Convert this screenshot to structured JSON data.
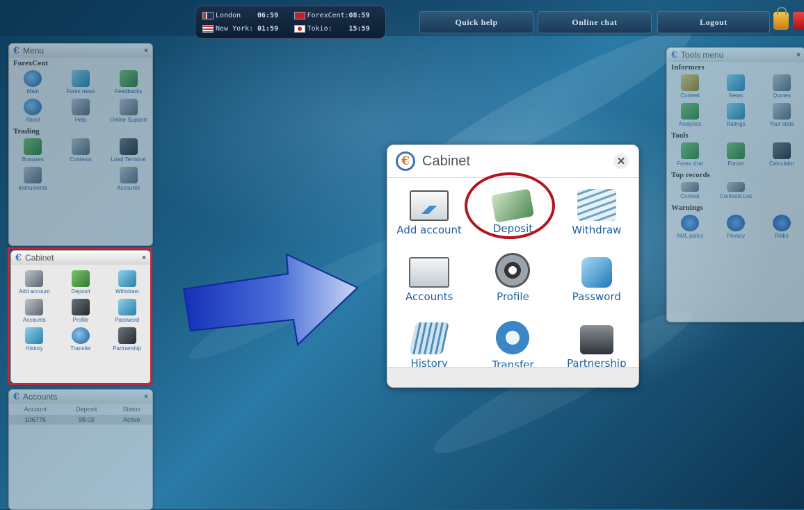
{
  "clocks": [
    {
      "city": "London",
      "time": "06:59",
      "flag": "uk"
    },
    {
      "city": "ForexCent:",
      "time": "08:59",
      "flag": "fc"
    },
    {
      "city": "New York:",
      "time": "01:59",
      "flag": "us"
    },
    {
      "city": "Tokio:",
      "time": "15:59",
      "flag": "jp"
    }
  ],
  "topbar": {
    "quick_help": "Quick help",
    "online_chat": "Online chat",
    "logout": "Logout"
  },
  "menu": {
    "title": "Menu",
    "sections": [
      {
        "name": "ForexCent",
        "items": [
          "Main",
          "Forex news",
          "Feedbacks",
          "About",
          "Help",
          "Online Support"
        ]
      },
      {
        "name": "Trading",
        "items": [
          "Bonuses",
          "Contests",
          "Load Terminal",
          "Instruments",
          "",
          "Accounts"
        ]
      }
    ]
  },
  "small_cabinet": {
    "title": "Cabinet",
    "items": [
      "Add account",
      "Deposit",
      "Withdraw",
      "Accounts",
      "Profile",
      "Password",
      "History",
      "Transfer",
      "Partnership"
    ]
  },
  "accounts_panel": {
    "title": "Accounts",
    "headers": [
      "Account",
      "Deposit",
      "Status"
    ],
    "rows": [
      [
        "106776",
        "98.03",
        "Active"
      ]
    ]
  },
  "tools_menu": {
    "title": "Tools menu",
    "sections": [
      {
        "name": "Informers",
        "items": [
          "Contest",
          "News",
          "Quotes",
          "Analytics",
          "Ratings",
          "Your stats"
        ]
      },
      {
        "name": "Tools",
        "items": [
          "Forex chat",
          "Forum",
          "Calculator"
        ]
      },
      {
        "name": "Top records",
        "items": [
          "Contest",
          "Contests List"
        ]
      },
      {
        "name": "Warnings",
        "items": [
          "AML policy",
          "Privacy",
          "Risks"
        ]
      }
    ]
  },
  "cabinet_dialog": {
    "title": "Cabinet",
    "items": [
      {
        "label": "Add account",
        "icon": "add-account-icon"
      },
      {
        "label": "Deposit",
        "icon": "deposit-icon"
      },
      {
        "label": "Withdraw",
        "icon": "withdraw-icon"
      },
      {
        "label": "Accounts",
        "icon": "accounts-icon"
      },
      {
        "label": "Profile",
        "icon": "profile-icon"
      },
      {
        "label": "Password",
        "icon": "password-icon"
      },
      {
        "label": "History",
        "icon": "history-icon"
      },
      {
        "label": "Transfer",
        "icon": "transfer-icon"
      },
      {
        "label": "Partnership",
        "icon": "partnership-icon"
      }
    ]
  },
  "colors": {
    "highlight": "#c6263a",
    "link_blue": "#1f5f9e",
    "brand_orange": "#e07b1a"
  }
}
